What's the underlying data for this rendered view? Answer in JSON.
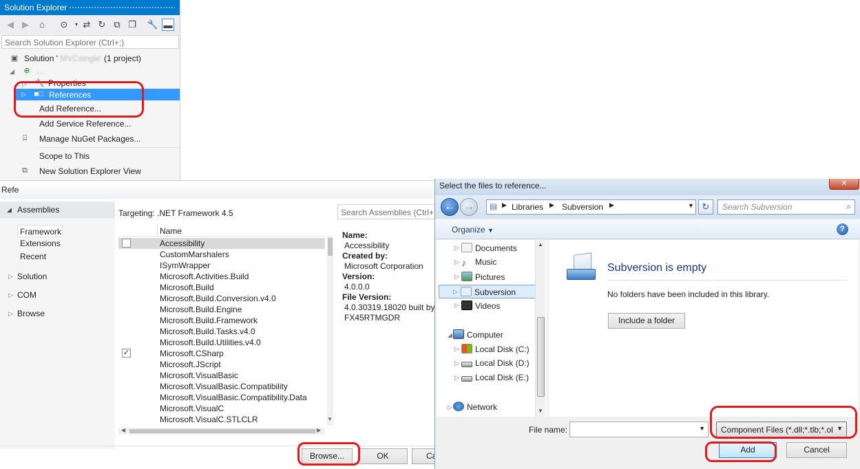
{
  "solution_explorer": {
    "title": "Solution Explorer",
    "search_placeholder": "Search Solution Explorer (Ctrl+;)",
    "solution_label": "Solution '",
    "solution_count": "(1 project)",
    "project_name": "...",
    "properties_label": "Properties",
    "references_label": "References"
  },
  "context_menu": {
    "items": [
      "Add Reference...",
      "Add Service Reference...",
      "Manage NuGet Packages...",
      "Scope to This",
      "New Solution Explorer View"
    ]
  },
  "reference_manager": {
    "title": "Refe",
    "nav": {
      "assemblies": "Assemblies",
      "framework": "Framework",
      "extensions": "Extensions",
      "recent": "Recent",
      "solution": "Solution",
      "com": "COM",
      "browse": "Browse"
    },
    "targeting": "Targeting: .NET Framework 4.5",
    "search_placeholder": "Search Assemblies (Ctrl+E",
    "column_name": "Name",
    "assemblies": [
      "Accessibility",
      "CustomMarshalers",
      "ISymWrapper",
      "Microsoft.Activities.Build",
      "Microsoft.Build",
      "Microsoft.Build.Conversion.v4.0",
      "Microsoft.Build.Engine",
      "Microsoft.Build.Framework",
      "Microsoft.Build.Tasks.v4.0",
      "Microsoft.Build.Utilities.v4.0",
      "Microsoft.CSharp",
      "Microsoft.JScript",
      "Microsoft.VisualBasic",
      "Microsoft.VisualBasic.Compatibility",
      "Microsoft.VisualBasic.Compatibility.Data",
      "Microsoft.VisualC",
      "Microsoft.VisualC.STLCLR"
    ],
    "details": {
      "name_label": "Name:",
      "name_value": "Accessibility",
      "created_label": "Created by:",
      "created_value": "Microsoft Corporation",
      "version_label": "Version:",
      "version_value": "4.0.0.0",
      "file_version_label": "File Version:",
      "file_version_value": "4.0.30319.18020 built by:",
      "file_version_value2": "FX45RTMGDR"
    },
    "buttons": {
      "browse": "Browse...",
      "ok": "OK",
      "cancel": "Ca"
    }
  },
  "file_dialog": {
    "title": "Select the files to reference...",
    "breadcrumb": [
      "Libraries",
      "Subversion"
    ],
    "search_placeholder": "Search Subversion",
    "organize": "Organize",
    "nav_items": [
      "Documents",
      "Music",
      "Pictures",
      "Subversion",
      "Videos",
      "Computer",
      "Local Disk (C:)",
      "Local Disk (D:)",
      "Local Disk (E:)",
      "Network"
    ],
    "empty_title": "Subversion is empty",
    "empty_message": "No folders have been included in this library.",
    "include_button": "Include a folder",
    "file_name_label": "File name:",
    "filter_value": "Component Files (*.dll;*.tlb;*.ol",
    "add_button": "Add",
    "cancel_button": "Cancel"
  },
  "colors": {
    "vs_accent": "#007acc",
    "selection": "#3399ff",
    "annotation": "#e01b1b"
  }
}
